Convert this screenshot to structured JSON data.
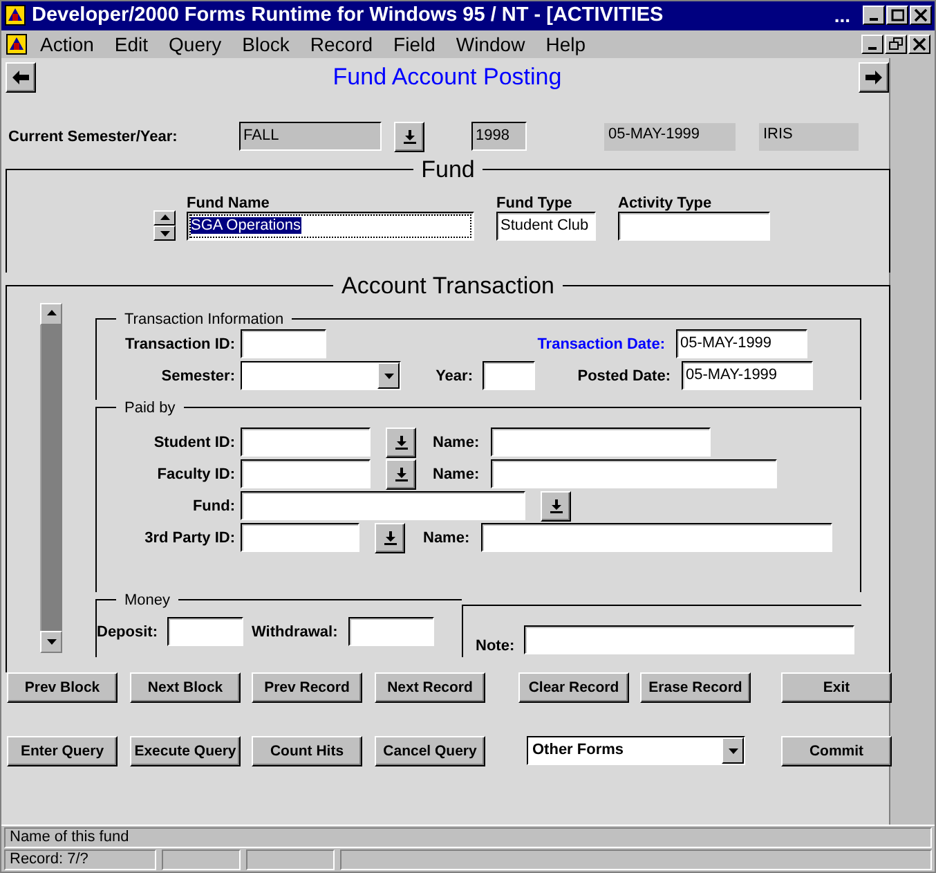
{
  "window": {
    "title": "Developer/2000 Forms Runtime for Windows 95 / NT - [ACTIVITIES",
    "title_overflow": "..."
  },
  "menu": [
    "Action",
    "Edit",
    "Query",
    "Block",
    "Record",
    "Field",
    "Window",
    "Help"
  ],
  "form_title": "Fund Account Posting",
  "current": {
    "label": "Current Semester/Year:",
    "semester": "FALL",
    "year": "1998",
    "date": "05-MAY-1999",
    "user": "IRIS"
  },
  "fund": {
    "title": "Fund",
    "fields": [
      {
        "label": "Fund Name",
        "value": "SGA Operations",
        "text_selected": true
      },
      {
        "label": "Fund Type",
        "value": "Student Club",
        "text_selected": false
      },
      {
        "label": "Activity Type",
        "text_selected": false
      }
    ]
  },
  "account": {
    "title": "Account Transaction",
    "transaction": {
      "title": "Transaction Information",
      "id_label": "Transaction ID:",
      "date_label": "Transaction Date:",
      "date": "05-MAY-1999",
      "semester_label": "Semester:",
      "year_label": "Year:",
      "posted_label": "Posted Date:",
      "posted": "05-MAY-1999"
    },
    "paid_by": {
      "title": "Paid by",
      "rows": [
        {
          "kind": "id",
          "label": "Student ID:",
          "name_label": "Name:"
        },
        {
          "kind": "id",
          "label": "Faculty ID:",
          "name_label": "Name:"
        },
        {
          "kind": "fund",
          "label": "Fund:"
        },
        {
          "kind": "id",
          "label": "3rd Party ID:",
          "name_label": "Name:"
        }
      ]
    },
    "money": {
      "title": "Money",
      "deposit_label": "Deposit:",
      "withdrawal_label": "Withdrawal:",
      "note_label": "Note:"
    }
  },
  "buttons_row1": [
    {
      "kind": "button",
      "label": "Prev Block"
    },
    {
      "kind": "button",
      "label": "Next Block"
    },
    {
      "kind": "button",
      "label": "Prev Record"
    },
    {
      "kind": "button",
      "label": "Next Record"
    },
    {
      "kind": "button",
      "label": "Clear Record"
    },
    {
      "kind": "button",
      "label": "Erase Record"
    },
    {
      "kind": "button",
      "label": "Exit"
    }
  ],
  "buttons_row2": [
    {
      "kind": "button",
      "label": "Enter Query"
    },
    {
      "kind": "button",
      "label": "Execute Query"
    },
    {
      "kind": "button",
      "label": "Count Hits"
    },
    {
      "kind": "button",
      "label": "Cancel Query"
    },
    {
      "kind": "dropdown",
      "label": "Other Forms"
    },
    {
      "kind": "button",
      "label": "Commit"
    }
  ],
  "status": {
    "hint": "Name of this fund",
    "record": "Record: 7/?"
  }
}
